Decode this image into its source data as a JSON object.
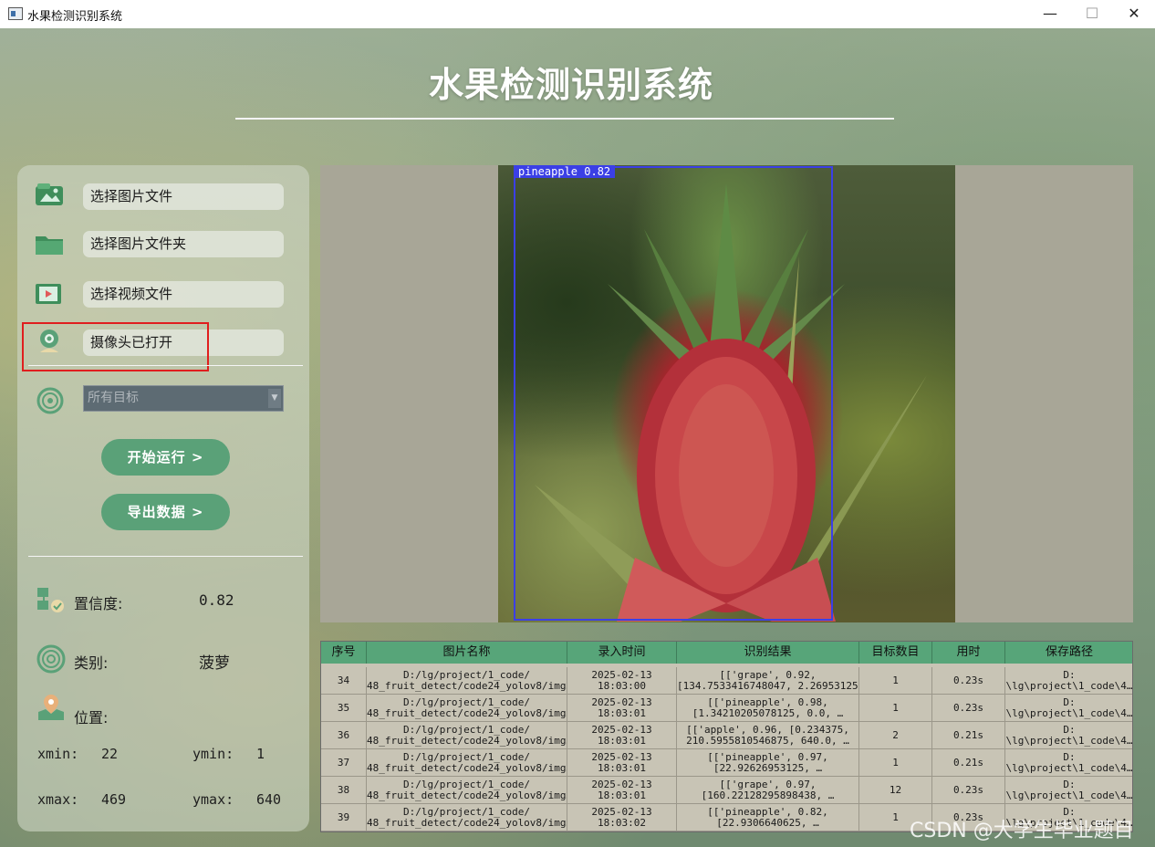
{
  "window": {
    "title": "水果检测识别系统",
    "minimize": "—",
    "maximize": "☐",
    "close": "✕"
  },
  "header": {
    "title": "水果检测识别系统"
  },
  "sidebar": {
    "buttons": [
      {
        "label": "选择图片文件",
        "icon": "image-file-icon"
      },
      {
        "label": "选择图片文件夹",
        "icon": "folder-icon"
      },
      {
        "label": "选择视频文件",
        "icon": "video-file-icon"
      },
      {
        "label": "摄像头已打开",
        "icon": "camera-icon"
      }
    ],
    "target_select": {
      "value": "所有目标",
      "icon": "target-icon"
    },
    "run_button": "开始运行 >",
    "export_button": "导出数据 >",
    "confidence": {
      "label": "置信度:",
      "value": "0.82"
    },
    "category": {
      "label": "类别:",
      "value": "菠萝"
    },
    "position": {
      "label": "位置:"
    },
    "coords": {
      "xmin_label": "xmin:",
      "xmin": "22",
      "ymin_label": "ymin:",
      "ymin": "1",
      "xmax_label": "xmax:",
      "xmax": "469",
      "ymax_label": "ymax:",
      "ymax": "640"
    }
  },
  "detection": {
    "label": "pineapple 0.82",
    "box_color": "#3b3fe6"
  },
  "table": {
    "headers": [
      "序号",
      "图片名称",
      "录入时间",
      "识别结果",
      "目标数目",
      "用时",
      "保存路径"
    ],
    "rows": [
      {
        "id": "34",
        "name1": "D:/lg/project/1_code/",
        "name2": "48_fruit_detect/code24_yolov8/img…",
        "time1": "2025-02-13",
        "time2": "18:03:00",
        "res1": "[['grape', 0.92,",
        "res2": "[134.7533416748047, 2.26953125…",
        "count": "1",
        "used": "0.23s",
        "path1": "D:",
        "path2": "\\lg\\project\\1_code\\4…"
      },
      {
        "id": "35",
        "name1": "D:/lg/project/1_code/",
        "name2": "48_fruit_detect/code24_yolov8/img…",
        "time1": "2025-02-13",
        "time2": "18:03:01",
        "res1": "[['pineapple', 0.98,",
        "res2": "[1.34210205078125, 0.0, …",
        "count": "1",
        "used": "0.23s",
        "path1": "D:",
        "path2": "\\lg\\project\\1_code\\4…"
      },
      {
        "id": "36",
        "name1": "D:/lg/project/1_code/",
        "name2": "48_fruit_detect/code24_yolov8/img…",
        "time1": "2025-02-13",
        "time2": "18:03:01",
        "res1": "[['apple', 0.96, [0.234375,",
        "res2": "210.5955810546875, 640.0, …",
        "count": "2",
        "used": "0.21s",
        "path1": "D:",
        "path2": "\\lg\\project\\1_code\\4…"
      },
      {
        "id": "37",
        "name1": "D:/lg/project/1_code/",
        "name2": "48_fruit_detect/code24_yolov8/img…",
        "time1": "2025-02-13",
        "time2": "18:03:01",
        "res1": "[['pineapple', 0.97,",
        "res2": "[22.92626953125, …",
        "count": "1",
        "used": "0.21s",
        "path1": "D:",
        "path2": "\\lg\\project\\1_code\\4…"
      },
      {
        "id": "38",
        "name1": "D:/lg/project/1_code/",
        "name2": "48_fruit_detect/code24_yolov8/img…",
        "time1": "2025-02-13",
        "time2": "18:03:01",
        "res1": "[['grape', 0.97,",
        "res2": "[160.22128295898438, …",
        "count": "12",
        "used": "0.23s",
        "path1": "D:",
        "path2": "\\lg\\project\\1_code\\4…"
      },
      {
        "id": "39",
        "name1": "D:/lg/project/1_code/",
        "name2": "48_fruit_detect/code24_yolov8/img…",
        "time1": "2025-02-13",
        "time2": "18:03:02",
        "res1": "[['pineapple', 0.82,",
        "res2": "[22.9306640625, …",
        "count": "1",
        "used": "0.23s",
        "path1": "D:",
        "path2": "\\lg\\project\\1_code\\4…"
      }
    ]
  },
  "watermark": "CSDN @大学生毕业题目"
}
